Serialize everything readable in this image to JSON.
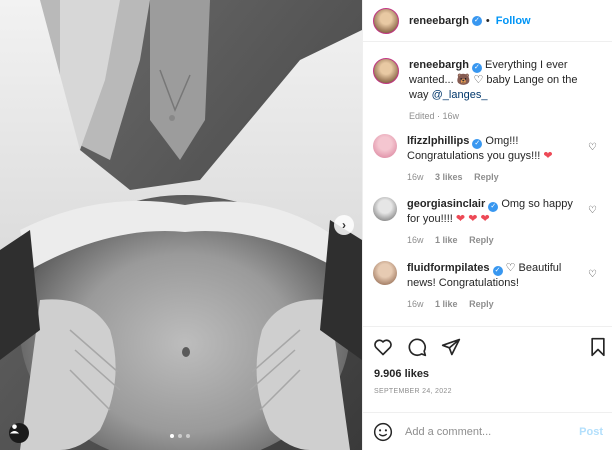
{
  "author": {
    "username": "reneebargh",
    "verified_glyph": "✓",
    "separator": "•",
    "follow_label": "Follow"
  },
  "caption": {
    "text": "Everything I ever wanted... 🐻 ",
    "text2": " baby Lange on the way ",
    "mention": "@_langes_",
    "meta": "Edited · 16w"
  },
  "comments": [
    {
      "username": "lfizzlphillips",
      "text": "Omg!!! Congratulations you guys!!! ",
      "hearts": "❤",
      "time": "16w",
      "likes": "3 likes",
      "reply": "Reply"
    },
    {
      "username": "georgiasinclair",
      "text": "Omg so happy for you!!!! ",
      "hearts": "❤ ❤ ❤",
      "time": "16w",
      "likes": "1 like",
      "reply": "Reply"
    },
    {
      "username": "fluidformpilates",
      "text": " Beautiful news! Congratulations!",
      "time": "16w",
      "likes": "1 like",
      "reply": "Reply"
    }
  ],
  "post": {
    "likes": "9.906 likes",
    "date": "SEPTEMBER 24, 2022",
    "comment_placeholder": "Add a comment...",
    "post_label": "Post"
  },
  "carousel": {
    "total": 3,
    "active_index": 0
  },
  "icons": [
    "heart-icon",
    "comment-icon",
    "share-icon",
    "bookmark-icon",
    "emoji-icon",
    "user-tag-icon",
    "chevron-right-icon"
  ],
  "colors": {
    "link": "#0095f6",
    "verified": "#3897f0",
    "heart_red": "#ed4956"
  }
}
